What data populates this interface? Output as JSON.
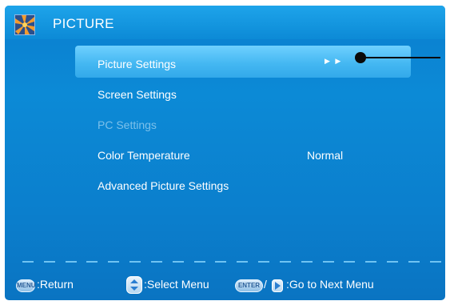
{
  "header": {
    "title": "PICTURE",
    "logo_icon": "picture-logo-icon"
  },
  "menu": {
    "items": [
      {
        "label": "Picture Settings",
        "value": "",
        "selected": true,
        "enabled": true
      },
      {
        "label": "Screen Settings",
        "value": "",
        "selected": false,
        "enabled": true
      },
      {
        "label": "PC Settings",
        "value": "",
        "selected": false,
        "enabled": false
      },
      {
        "label": "Color Temperature",
        "value": "Normal",
        "selected": false,
        "enabled": true
      },
      {
        "label": "Advanced Picture Settings",
        "value": "",
        "selected": false,
        "enabled": true
      }
    ],
    "submenu_arrow": "▶ ▶"
  },
  "footer": {
    "menu_key": "MENU",
    "return_label": ":Return",
    "select_label": ":Select Menu",
    "enter_key": "ENTER",
    "separator": "/",
    "next_label": ":Go to Next Menu"
  },
  "colors": {
    "background": "#0a7ecf",
    "highlight": "#45b8f2",
    "disabled_text": "#7cc0ea"
  }
}
